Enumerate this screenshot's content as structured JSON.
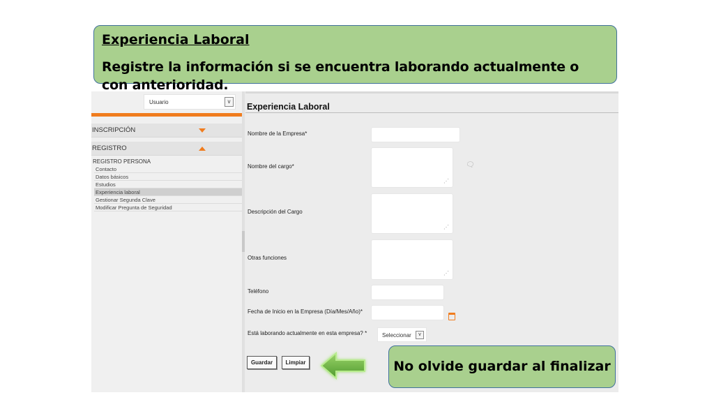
{
  "callout_top": {
    "title": "Experiencia Laboral",
    "text": "Registre la información si se encuentra laborando actualmente o con anterioridad."
  },
  "callout_bottom": {
    "text": "No olvide guardar al finalizar"
  },
  "sidebar": {
    "user_select": "Usuario",
    "sections": [
      {
        "label": "INSCRIPCIÓN",
        "expanded": false
      },
      {
        "label": "REGISTRO",
        "expanded": true
      }
    ],
    "subsection_title": "REGISTRO PERSONA",
    "items": [
      {
        "label": "Contacto",
        "active": false
      },
      {
        "label": "Datos básicos",
        "active": false
      },
      {
        "label": "Estudios",
        "active": false
      },
      {
        "label": "Experiencia laboral",
        "active": true
      },
      {
        "label": "Gestionar Segunda Clave",
        "active": false
      },
      {
        "label": "Modificar Pregunta de Seguridad",
        "active": false
      }
    ]
  },
  "form": {
    "title": "Experiencia Laboral",
    "fields": {
      "empresa": {
        "label": "Nombre de la Empresa*",
        "value": ""
      },
      "cargo": {
        "label": "Nombre del cargo*",
        "value": ""
      },
      "descripcion": {
        "label": "Descripción del Cargo",
        "value": ""
      },
      "otras": {
        "label": "Otras funciones",
        "value": ""
      },
      "telefono": {
        "label": "Teléfono",
        "value": ""
      },
      "fecha_inicio": {
        "label": "Fecha de Inicio en la Empresa (Día/Mes/Año)*",
        "value": ""
      },
      "laborando": {
        "label": "Está laborando actualmente en esta empresa? *",
        "selected": "Seleccionar"
      }
    },
    "buttons": {
      "save": "Guardar",
      "clear": "Limpiar"
    }
  },
  "colors": {
    "callout_fill": "#a9d08e",
    "callout_border": "#41719c",
    "accent_orange": "#f07c1e",
    "arrow_green": "#70ad47"
  },
  "icons": {
    "expand": "chevron-down-icon",
    "collapse": "chevron-up-icon",
    "calendar": "calendar-icon",
    "comment": "comment-icon",
    "arrow": "left-arrow-icon"
  }
}
